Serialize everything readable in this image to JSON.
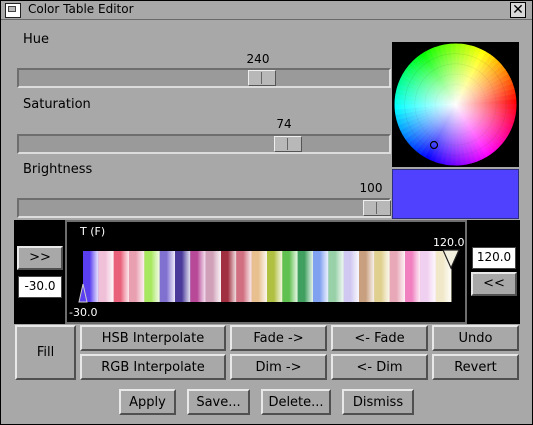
{
  "window": {
    "title": "Color Table Editor",
    "close_glyph": "✕"
  },
  "hue": {
    "label": "Hue",
    "value": "240",
    "position_fraction": 0.667
  },
  "saturation": {
    "label": "Saturation",
    "value": "74",
    "position_fraction": 0.74
  },
  "brightness": {
    "label": "Brightness",
    "value": "100",
    "position_fraction": 1.0
  },
  "preview": {
    "color": "#5041ff"
  },
  "colorbar": {
    "axis_label": "T (F)",
    "min_label": "-30.0",
    "max_label": "120.0",
    "min_value": "-30.0",
    "max_value": "120.0",
    "left_btn": ">>",
    "right_btn": "<<",
    "bands": [
      "#5a3ff0",
      "#f0c0d8",
      "#e8607a",
      "#e8a0b0",
      "#a8e860",
      "#8070d0",
      "#4a3a9a",
      "#b84898",
      "#d0a0b8",
      "#a03040",
      "#d07080",
      "#e8c090",
      "#b0c040",
      "#60c050",
      "#40a060",
      "#80a0f0",
      "#98d0a8",
      "#d0c8f0",
      "#c8a080",
      "#e0d090",
      "#e8a8b8",
      "#f080c0",
      "#f0d0f0",
      "#f0e8c8"
    ]
  },
  "buttons": {
    "fill": "Fill",
    "hsb_interpolate": "HSB Interpolate",
    "rgb_interpolate": "RGB Interpolate",
    "fade_right": "Fade ->",
    "fade_left": "<- Fade",
    "dim_right": "Dim ->",
    "dim_left": "<- Dim",
    "undo": "Undo",
    "revert": "Revert",
    "apply": "Apply",
    "save": "Save...",
    "delete": "Delete...",
    "dismiss": "Dismiss"
  }
}
